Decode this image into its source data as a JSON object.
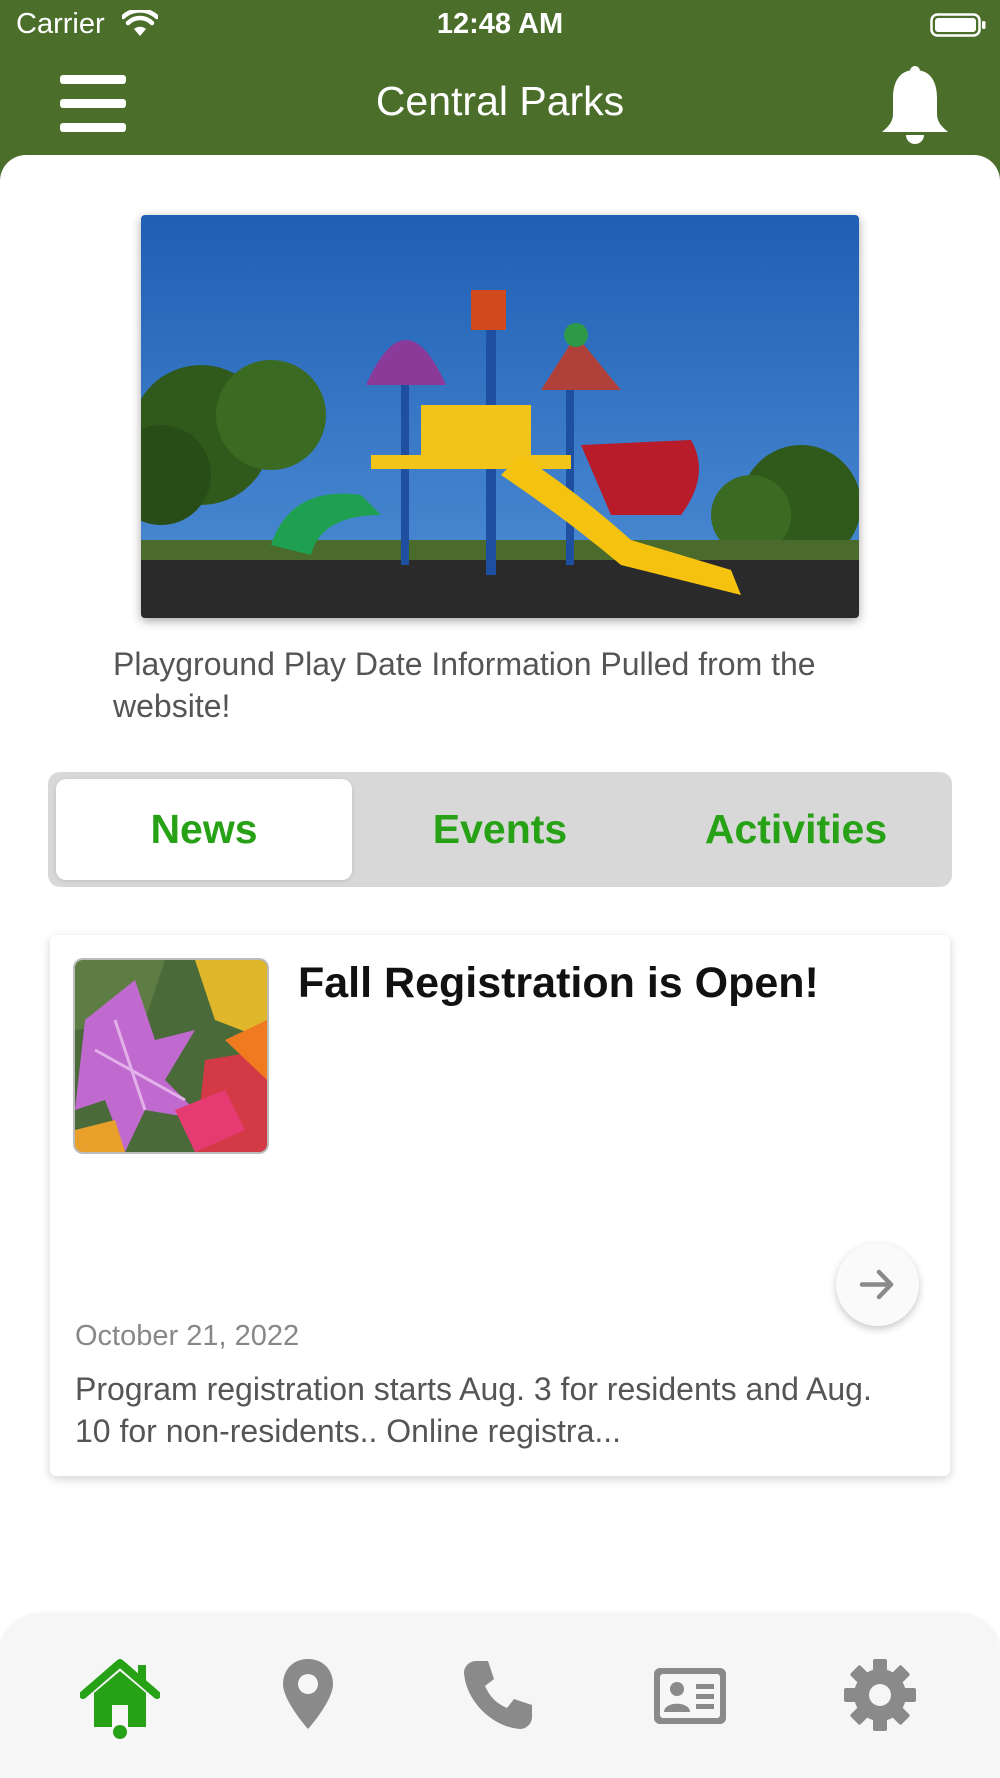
{
  "status_bar": {
    "carrier": "Carrier",
    "time": "12:48 AM"
  },
  "nav": {
    "title": "Central Parks",
    "left_icon": "menu-icon",
    "right_icon": "bell-icon"
  },
  "hero": {
    "caption": "Playground Play Date Information Pulled from the website!"
  },
  "segments": [
    {
      "label": "News",
      "selected": true
    },
    {
      "label": "Events",
      "selected": false
    },
    {
      "label": "Activities",
      "selected": false
    }
  ],
  "news": [
    {
      "title": "Fall Registration is Open!",
      "date": "October 21, 2022",
      "summary": "Program registration starts Aug. 3 for residents and Aug. 10 for non-residents.. Online registra..."
    }
  ],
  "tab_bar": {
    "items": [
      {
        "icon": "home-icon",
        "selected": true
      },
      {
        "icon": "location-pin-icon",
        "selected": false
      },
      {
        "icon": "phone-icon",
        "selected": false
      },
      {
        "icon": "contact-card-icon",
        "selected": false
      },
      {
        "icon": "gear-icon",
        "selected": false
      }
    ]
  },
  "colors": {
    "header_green": "#4b6f2b",
    "accent_green": "#27a115",
    "icon_gray": "#8a8a8a"
  }
}
